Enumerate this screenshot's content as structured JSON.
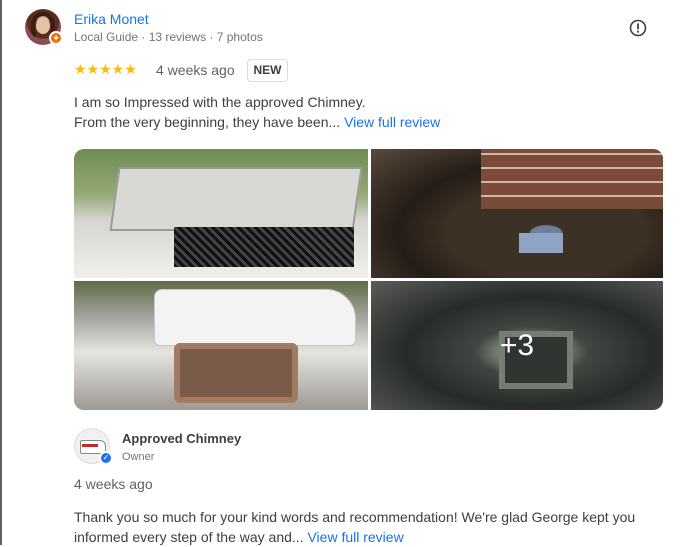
{
  "review": {
    "reviewer_name": "Erika Monet",
    "reviewer_meta": "Local Guide · 13 reviews · 7 photos",
    "rating": 5,
    "stars": "★★★★★",
    "date": "4 weeks ago",
    "badge": "NEW",
    "text_line1": "I am so Impressed with the approved Chimney.",
    "text_line2": "From the very beginning, they have been...",
    "view_full_review": "View full review",
    "more_photos": "+3"
  },
  "response": {
    "owner_name": "Approved Chimney",
    "owner_role": "Owner",
    "date": "4 weeks ago",
    "text_line1": "Thank you so much for your kind words and recommendation! We're glad George kept you",
    "text_line2": "informed every step of the way and...",
    "view_full_review": "View full review"
  },
  "colors": {
    "link": "#1a73e8",
    "star": "#fbbc04",
    "local_guide_badge": "#e8710a",
    "verified_badge": "#1a73e8"
  },
  "icons": {
    "report": "report-icon",
    "local_guide": "local-guide-icon",
    "verified": "verified-icon"
  }
}
